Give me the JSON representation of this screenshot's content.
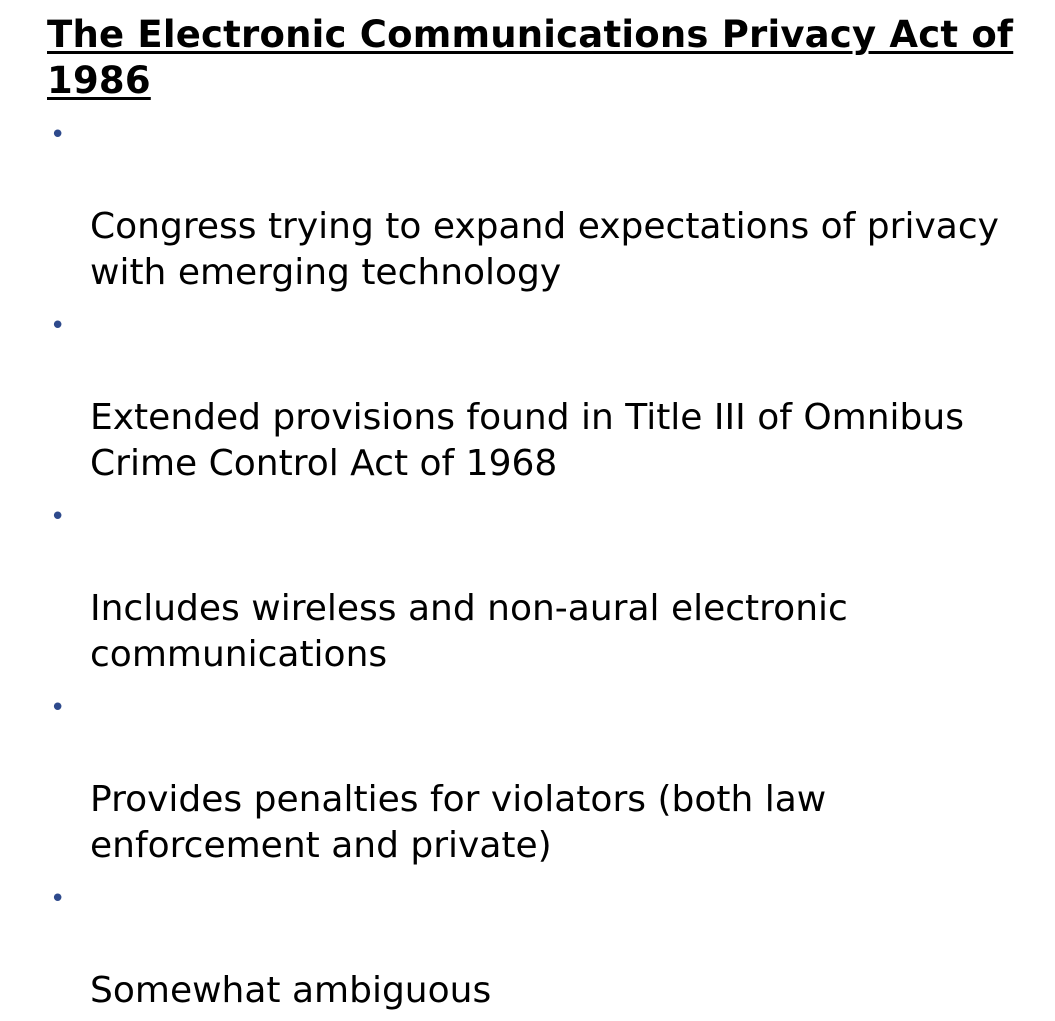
{
  "slide": {
    "title": "The Electronic Communications Privacy Act of 1986",
    "bullet_symbol": "•",
    "bullet_color": "#2e4a8c",
    "bullets": [
      {
        "text": "Congress trying to expand expectations of privacy\nwith emerging technology"
      },
      {
        "text": "Extended provisions found in Title III of Omnibus\nCrime Control Act of 1968"
      },
      {
        "text": "Includes wireless and non-aural electronic\ncommunications"
      },
      {
        "text": "Provides penalties for violators (both law\nenforcement and private)"
      },
      {
        "text": "Somewhat ambiguous"
      }
    ]
  }
}
